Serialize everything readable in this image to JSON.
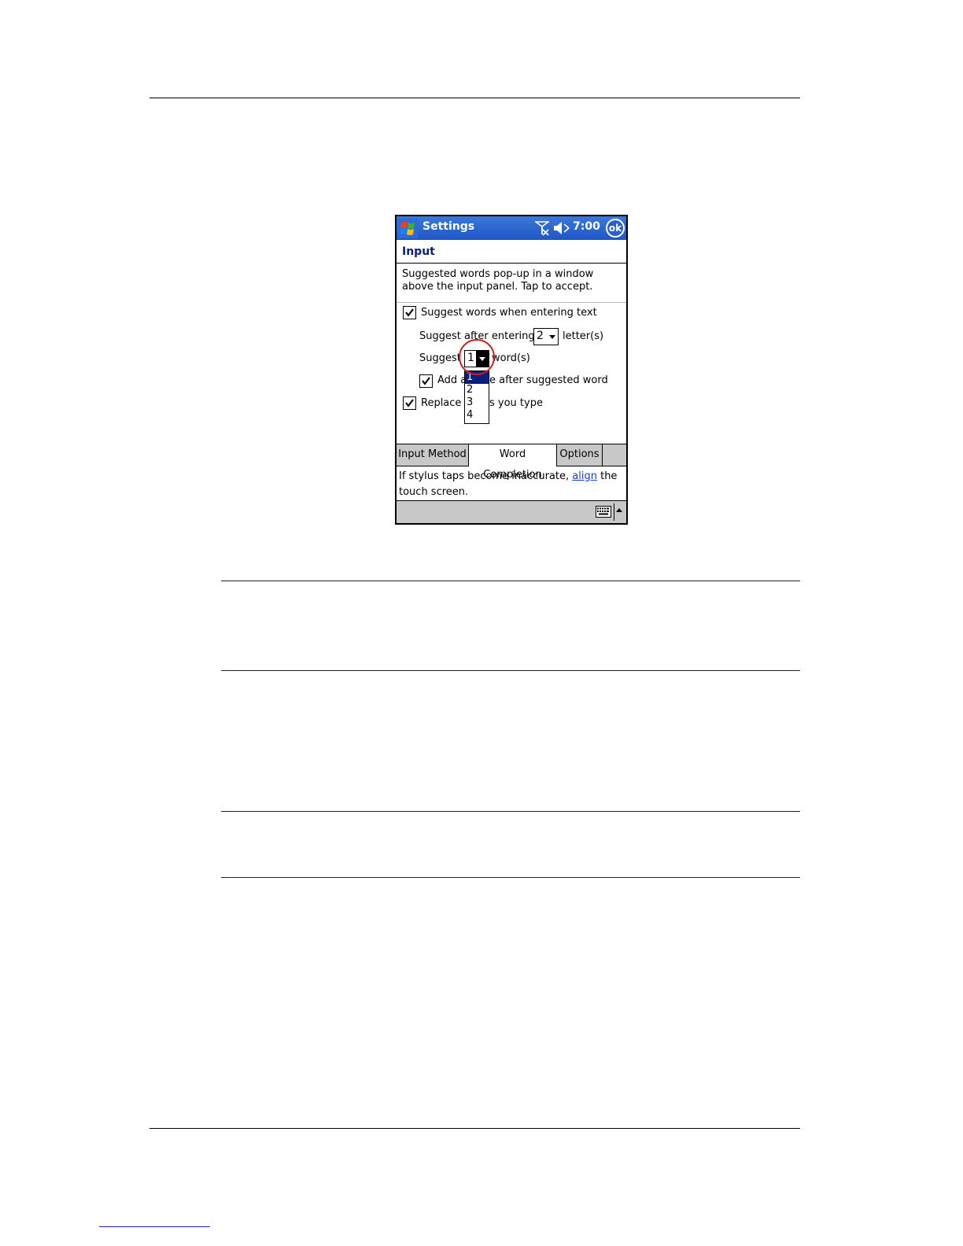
{
  "device": {
    "titlebar": {
      "title": "Settings",
      "clock": "7:00",
      "ok_label": "ok"
    },
    "section_title": "Input",
    "description": "Suggested words pop-up in a window above the input panel.  Tap to accept.",
    "options": {
      "suggest_words_label": "Suggest words when entering text",
      "suggest_words_checked": true,
      "suggest_after_prefix": "Suggest after entering",
      "suggest_after_value": "2",
      "suggest_after_suffix": "letter(s)",
      "suggest_count_prefix": "Suggest",
      "suggest_count_value": "1",
      "suggest_count_suffix": "word(s)",
      "add_space_label_left": "Add a",
      "add_space_label_right": "e after suggested word",
      "add_space_checked": true,
      "replace_label_left": "Replace t",
      "replace_label_right": "s you type",
      "replace_checked": true
    },
    "dropdown_options": [
      "1",
      "2",
      "3",
      "4"
    ],
    "tabs": [
      {
        "label": "Input Method"
      },
      {
        "label": "Word Completion"
      },
      {
        "label": "Options"
      }
    ],
    "hint": {
      "before": "If stylus taps become inaccurate,",
      "link": "align",
      "after": "the touch screen."
    }
  },
  "colors": {
    "titlebar": "#1f57c6",
    "section_title": "#0a1f7a",
    "highlight_circle": "#d02020",
    "link": "#1a3cd8"
  }
}
